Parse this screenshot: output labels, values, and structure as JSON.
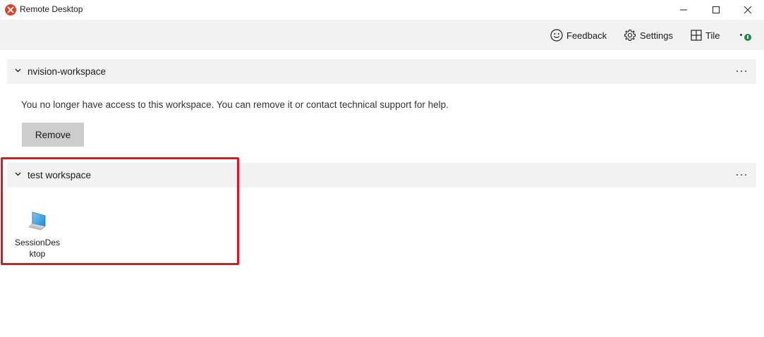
{
  "window": {
    "title": "Remote Desktop",
    "icon": "remote-desktop-app-icon",
    "controls": [
      "minimize-icon",
      "maximize-icon",
      "close-icon"
    ]
  },
  "commandbar": {
    "feedback_label": "Feedback",
    "settings_label": "Settings",
    "tile_label": "Tile",
    "account_icon": "account-icon",
    "account_badge_color": "#1e8a3e"
  },
  "workspaces": [
    {
      "name": "nvision-workspace",
      "message": "You no longer have access to this workspace. You can remove it or contact technical support for help.",
      "remove_label": "Remove"
    },
    {
      "name": "test workspace",
      "resources": [
        {
          "label": "SessionDesktop",
          "icon": "desktop-computer-icon"
        }
      ]
    }
  ],
  "colors": {
    "highlight": "#e81123",
    "app_icon": "#d9422b",
    "header_bg": "#f2f2f2",
    "button_bg": "#cccccc"
  }
}
